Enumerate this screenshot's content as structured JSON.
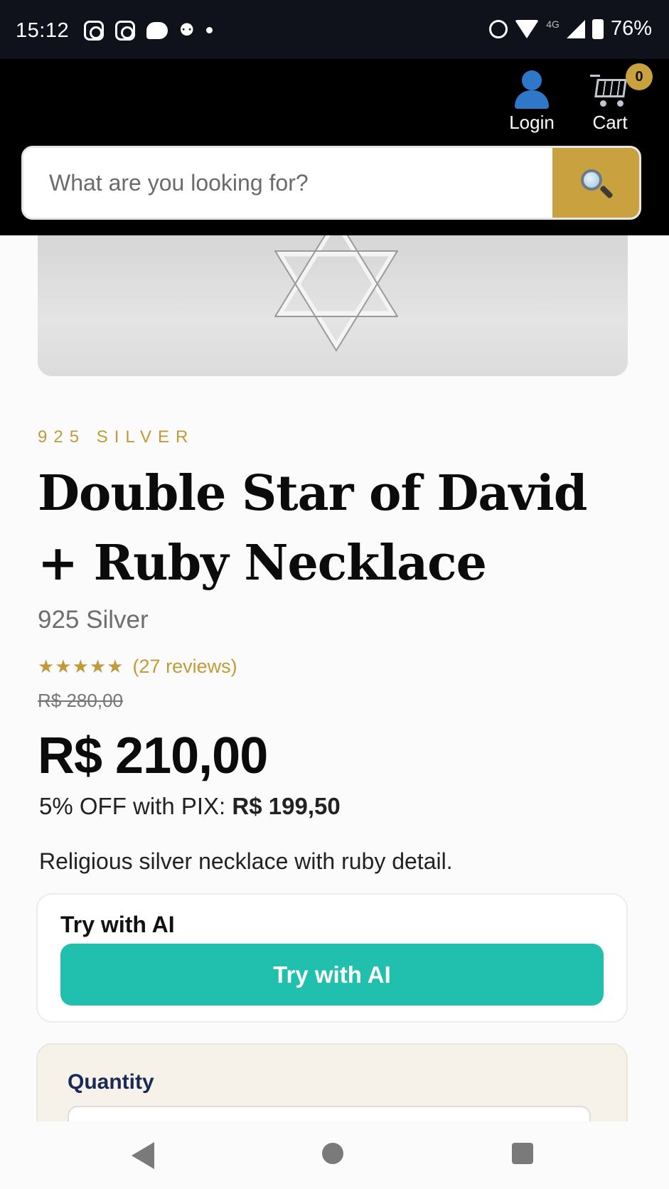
{
  "status_bar": {
    "time": "15:12",
    "network": "4G",
    "battery": "76%",
    "icons": [
      "instagram-icon",
      "instagram-icon",
      "chat-icon",
      "app-icon",
      "dot-icon",
      "alarm-icon",
      "wifi-icon",
      "signal-icon",
      "battery-icon"
    ]
  },
  "header": {
    "login_label": "Login",
    "cart_label": "Cart",
    "cart_count": "0",
    "search_placeholder": "What are you looking for?",
    "accent_color": "#c9a23f"
  },
  "product": {
    "category": "925 SILVER",
    "title": "Double Star of David + Ruby Necklace",
    "subtitle": "925 Silver",
    "rating": 5,
    "rating_stars": "★★★★★",
    "reviews": "(27 reviews)",
    "old_price": "R$ 280,00",
    "price": "R$ 210,00",
    "pix_prefix": "5% OFF with PIX:",
    "pix_price": "R$ 199,50",
    "description": "Religious silver necklace with ruby detail."
  },
  "ai": {
    "title": "Try with AI",
    "button_label": "Try with AI",
    "button_color": "#20bfae"
  },
  "quantity": {
    "label": "Quantity"
  }
}
